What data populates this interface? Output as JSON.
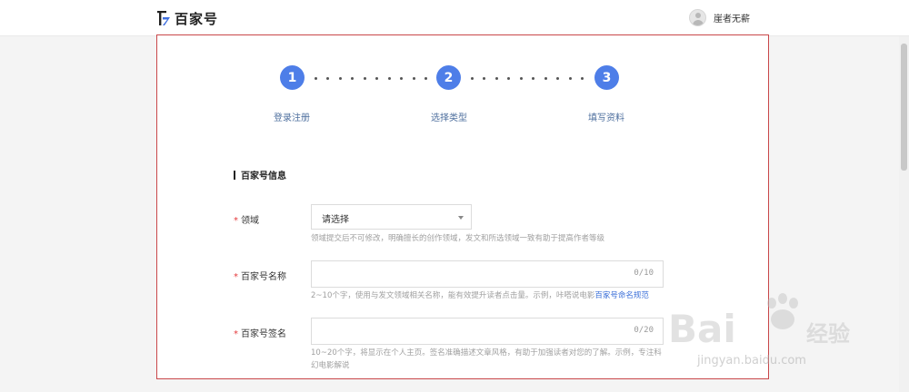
{
  "header": {
    "logo_text": "百家号",
    "user_name": "崖者无薪"
  },
  "steps": [
    {
      "number": "1",
      "label": "登录注册"
    },
    {
      "number": "2",
      "label": "选择类型"
    },
    {
      "number": "3",
      "label": "填写资料"
    }
  ],
  "section": {
    "title": "百家号信息"
  },
  "form": {
    "required_mark": "*",
    "domain": {
      "label": "领域",
      "selected": "请选择",
      "hint": "领域提交后不可修改，明确擅长的创作领域，发文和所选领域一致有助于提高作者等级"
    },
    "name": {
      "label": "百家号名称",
      "value": "",
      "counter": "0/10",
      "hint": "2~10个字，使用与发文领域相关名称，能有效提升读者点击量。示例，咔嗒说电影",
      "hint_link": "百家号命名规范"
    },
    "signature": {
      "label": "百家号签名",
      "value": "",
      "counter": "0/20",
      "hint": "10~20个字，将显示在个人主页。签名准确描述文章风格，有助于加强读者对您的了解。示例，专注科幻电影解说"
    }
  },
  "watermark": {
    "brand": "Bai",
    "brand_tail": "经验",
    "url": "jingyan.baidu.com"
  },
  "colors": {
    "accent": "#4e7ee8",
    "panel_border": "#c9474a",
    "required": "#e4393c",
    "link": "#3b6fd8"
  }
}
